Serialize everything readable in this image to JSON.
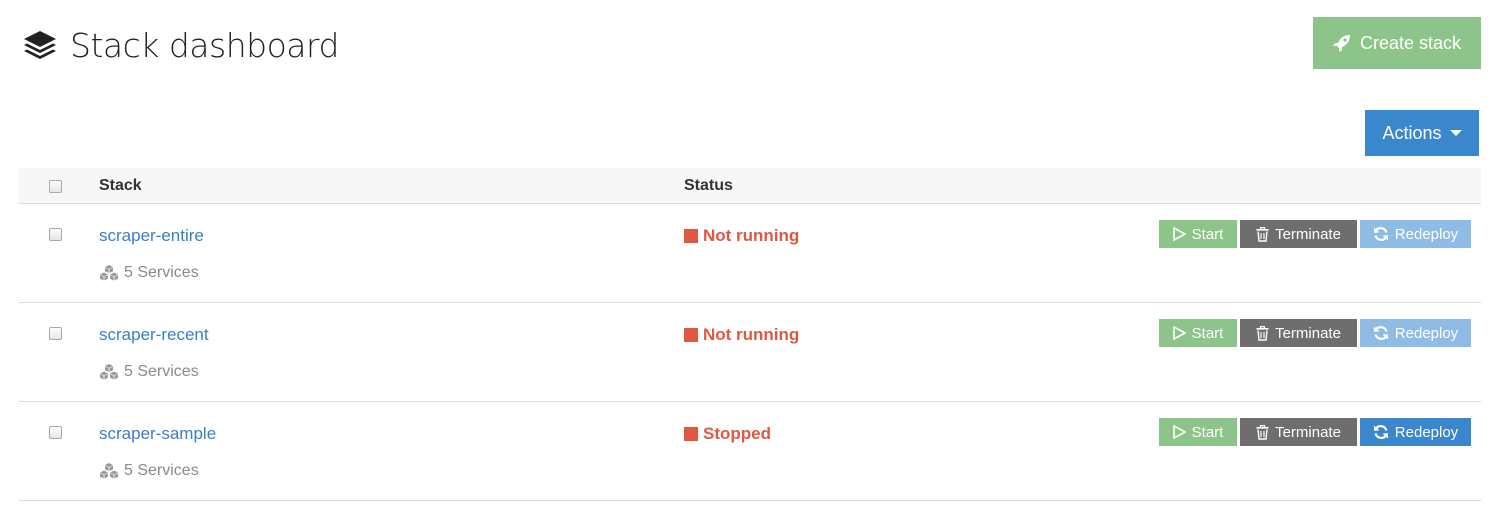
{
  "header": {
    "title": "Stack dashboard",
    "icon": "layers-icon"
  },
  "toolbar": {
    "create_label": "Create stack",
    "create_icon": "rocket-icon",
    "actions_label": "Actions"
  },
  "table": {
    "columns": [
      "Stack",
      "Status"
    ],
    "rows": [
      {
        "name": "scraper-entire",
        "services": "5 Services",
        "status": "Not running",
        "start": "Start",
        "terminate": "Terminate",
        "redeploy": "Redeploy",
        "redeploy_enabled": false
      },
      {
        "name": "scraper-recent",
        "services": "5 Services",
        "status": "Not running",
        "start": "Start",
        "terminate": "Terminate",
        "redeploy": "Redeploy",
        "redeploy_enabled": false
      },
      {
        "name": "scraper-sample",
        "services": "5 Services",
        "status": "Stopped",
        "start": "Start",
        "terminate": "Terminate",
        "redeploy": "Redeploy",
        "redeploy_enabled": true
      }
    ]
  },
  "colors": {
    "success": "#8dc48a",
    "primary": "#3b87cd",
    "primary_disabled": "#8ebce5",
    "danger": "#de5842",
    "neutral": "#6e6e6e",
    "link": "#3a7fc1"
  }
}
